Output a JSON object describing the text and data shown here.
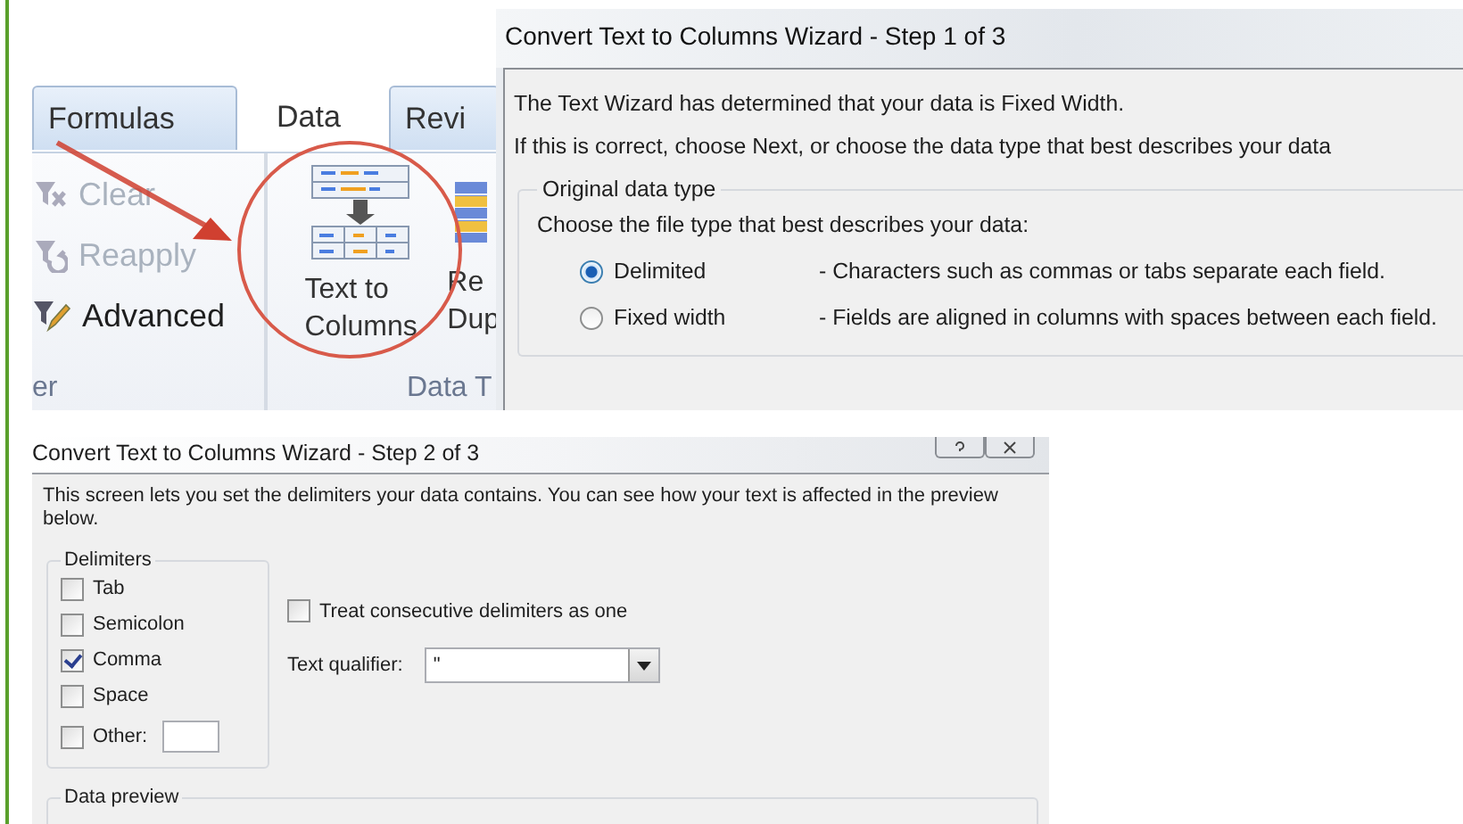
{
  "ribbon": {
    "tabs": [
      {
        "label": "Formulas",
        "selected": false
      },
      {
        "label": "Data",
        "selected": true
      },
      {
        "label": "Revi",
        "selected": false
      }
    ],
    "commands": [
      {
        "kind": "clear",
        "label": "Clear",
        "disabled": true
      },
      {
        "kind": "reapply",
        "label": "Reapply",
        "disabled": true
      },
      {
        "kind": "advanced",
        "label": "Advanced",
        "disabled": false
      }
    ],
    "left_group_label": "er",
    "big_buttons": [
      {
        "kind": "text-to-columns",
        "lines": [
          "Text to",
          "Columns"
        ]
      },
      {
        "kind": "remove-duplicates",
        "lines": [
          "Re",
          "Dup"
        ]
      }
    ],
    "right_group_label": "Data T"
  },
  "wizard_step1": {
    "title": "Convert Text to Columns Wizard - Step 1 of 3",
    "intro": [
      "The Text Wizard has determined that your data is Fixed Width.",
      "If this is correct, choose Next, or choose the data type that best describes your data"
    ],
    "legend": "Original data type",
    "prompt": "Choose the file type that best describes your data:",
    "options": [
      {
        "label": "Delimited",
        "description": "- Characters such as commas or tabs separate each field.",
        "selected": true
      },
      {
        "label": "Fixed width",
        "description": "- Fields are aligned in columns with spaces between each field.",
        "selected": false
      }
    ]
  },
  "wizard_step2": {
    "title": "Convert Text to Columns Wizard - Step 2 of 3",
    "intro": "This screen lets you set the delimiters your data contains.  You can see how your text is affected in the preview below.",
    "delimiters_legend": "Delimiters",
    "delimiters": [
      {
        "kind": "plain",
        "label": "Tab",
        "checked": false
      },
      {
        "kind": "plain",
        "label": "Semicolon",
        "checked": false
      },
      {
        "kind": "plain",
        "label": "Comma",
        "checked": true
      },
      {
        "kind": "plain",
        "label": "Space",
        "checked": false
      },
      {
        "kind": "other",
        "label": "Other:",
        "checked": false
      }
    ],
    "consecutive": {
      "label": "Treat consecutive delimiters as one",
      "checked": false
    },
    "qualifier": {
      "label": "Text qualifier:",
      "value": "\""
    },
    "preview_legend": "Data preview"
  }
}
